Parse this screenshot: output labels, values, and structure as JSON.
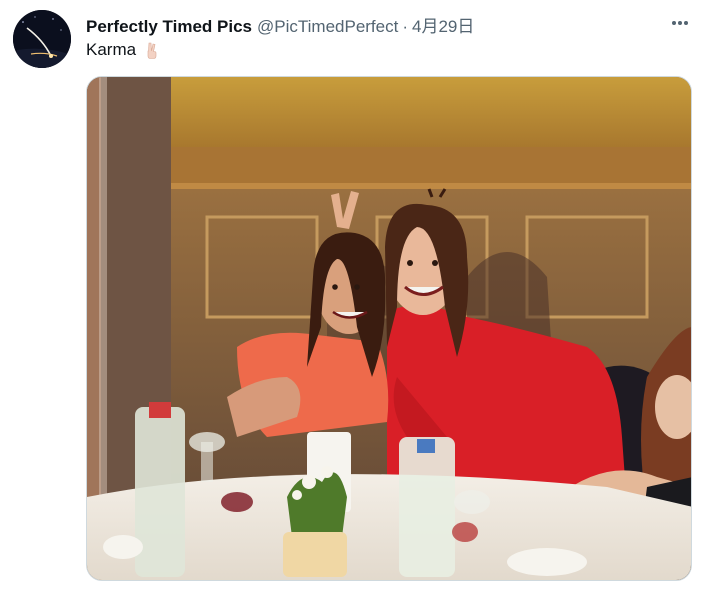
{
  "tweet": {
    "display_name": "Perfectly Timed Pics",
    "handle": "@PicTimedPerfect",
    "separator": "·",
    "date": "4月29日",
    "text": "Karma",
    "emoji": "victory-hand-emoji",
    "more_icon": "more-horizontal-icon"
  },
  "media": {
    "alt": "",
    "colors": {
      "wall_top": "#c49a3a",
      "wall_bottom": "#7a5a3a",
      "dress_red": "#e1202a",
      "dress_pink": "#f06a4e",
      "tablecloth": "#f1ebe1"
    }
  }
}
